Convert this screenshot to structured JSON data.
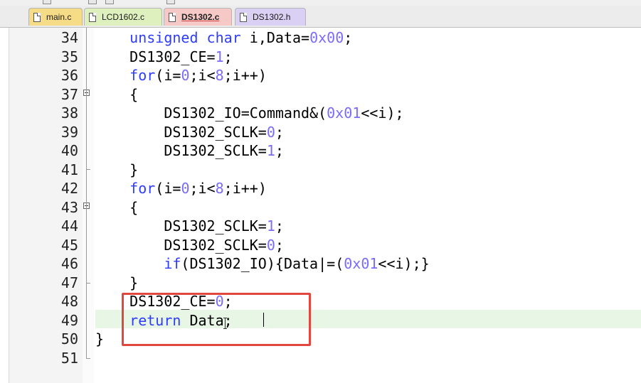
{
  "tabs": [
    {
      "label": "main.c",
      "color": "#f6dc86",
      "active": false
    },
    {
      "label": "LCD1602.c",
      "color": "#dff0bf",
      "active": false
    },
    {
      "label": "DS1302.c",
      "color": "#f6c9c7",
      "active": true
    },
    {
      "label": "DS1302.h",
      "color": "#dad0f3",
      "active": false
    }
  ],
  "colors": {
    "keyword": "#2d3cff",
    "number": "#7a6cff",
    "current_line": "#e8f6e6",
    "annotation_box": "#e3463f"
  },
  "editor": {
    "cursor_line": 49,
    "lines": [
      {
        "n": "34",
        "text": "    unsigned char i,Data=0x00;"
      },
      {
        "n": "35",
        "text": "    DS1302_CE=1;"
      },
      {
        "n": "36",
        "text": "    for(i=0;i<8;i++)"
      },
      {
        "n": "37",
        "text": "    {"
      },
      {
        "n": "38",
        "text": "        DS1302_IO=Command&(0x01<<i);"
      },
      {
        "n": "39",
        "text": "        DS1302_SCLK=0;"
      },
      {
        "n": "40",
        "text": "        DS1302_SCLK=1;"
      },
      {
        "n": "41",
        "text": "    }"
      },
      {
        "n": "42",
        "text": "    for(i=0;i<8;i++)"
      },
      {
        "n": "43",
        "text": "    {"
      },
      {
        "n": "44",
        "text": "        DS1302_SCLK=1;"
      },
      {
        "n": "45",
        "text": "        DS1302_SCLK=0;"
      },
      {
        "n": "46",
        "text": "        if(DS1302_IO){Data|=(0x01<<i);}"
      },
      {
        "n": "47",
        "text": "    }"
      },
      {
        "n": "48",
        "text": "    DS1302_CE=0;"
      },
      {
        "n": "49",
        "text": "    return Data;"
      },
      {
        "n": "50",
        "text": "}"
      },
      {
        "n": "51",
        "text": ""
      }
    ]
  }
}
